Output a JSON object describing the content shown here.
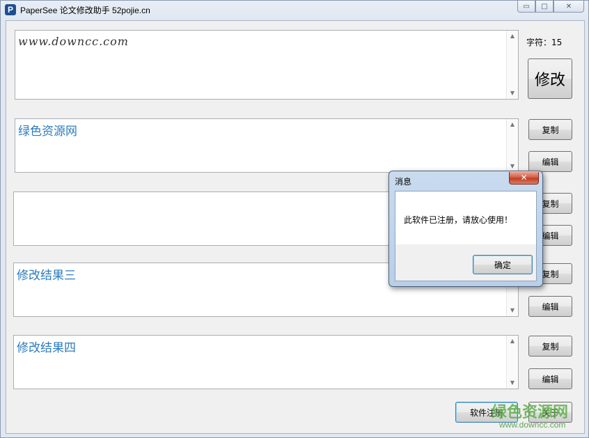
{
  "window": {
    "title": "PaperSee 论文修改助手 52pojie.cn",
    "icon_letter": "P",
    "controls": {
      "minimize": "▭",
      "maximize": "□",
      "close": "✕"
    }
  },
  "input_box": {
    "value": "www.downcc.com"
  },
  "char_count_label": "字符：15",
  "modify_button": "修改",
  "results": [
    {
      "value": "绿色资源网",
      "copy_label": "复制",
      "edit_label": "编辑"
    },
    {
      "value": "",
      "copy_label": "复制",
      "edit_label": "编辑"
    },
    {
      "value": "修改结果三",
      "copy_label": "复制",
      "edit_label": "编辑"
    },
    {
      "value": "修改结果四",
      "copy_label": "复制",
      "edit_label": "编辑"
    }
  ],
  "footer": {
    "register_label": "软件注册",
    "about_label": "关于"
  },
  "dialog": {
    "title": "消息",
    "close_glyph": "✕",
    "message": "此软件已注册，请放心使用！",
    "ok_label": "确定"
  },
  "watermark": {
    "text": "绿色资源网",
    "url": "www.downcc.com"
  },
  "colors": {
    "result_text": "#2b7bbf",
    "dialog_frame": "#b9cfe7",
    "close_red": "#c0391f"
  }
}
